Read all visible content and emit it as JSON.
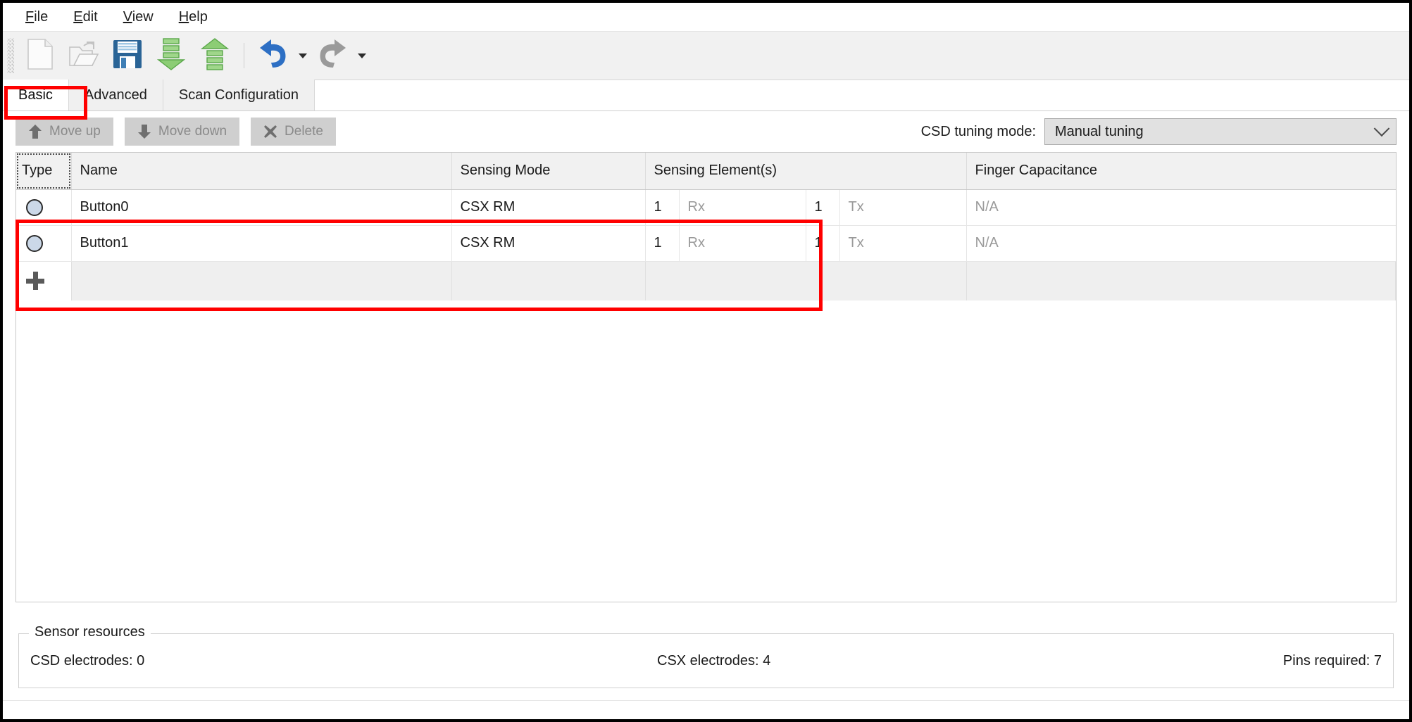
{
  "menu": {
    "items": [
      {
        "name": "file",
        "mnemonic": "F",
        "rest": "ile"
      },
      {
        "name": "edit",
        "mnemonic": "E",
        "rest": "dit"
      },
      {
        "name": "view",
        "mnemonic": "V",
        "rest": "iew"
      },
      {
        "name": "help",
        "mnemonic": "H",
        "rest": "elp"
      }
    ]
  },
  "toolbar": {
    "buttons": [
      {
        "icon": "new-document-icon",
        "enabled": false
      },
      {
        "icon": "open-folder-icon",
        "enabled": false
      },
      {
        "icon": "save-floppy-icon",
        "enabled": true
      },
      {
        "icon": "apply-to-device-down-arrow-icon",
        "enabled": true
      },
      {
        "icon": "read-from-device-up-arrow-icon",
        "enabled": true
      },
      {
        "icon": "undo-icon",
        "enabled": true
      },
      {
        "icon": "redo-icon",
        "enabled": false
      }
    ]
  },
  "tabs": [
    {
      "label": "Basic",
      "active": true
    },
    {
      "label": "Advanced",
      "active": false
    },
    {
      "label": "Scan Configuration",
      "active": false
    }
  ],
  "actions": {
    "move_up_label": "Move up",
    "move_down_label": "Move down",
    "delete_label": "Delete",
    "tuning_mode_label": "CSD tuning mode:",
    "tuning_mode_value": "Manual tuning"
  },
  "table": {
    "headers": {
      "type": "Type",
      "name": "Name",
      "sensing_mode": "Sensing Mode",
      "sensing_elements": "Sensing Element(s)",
      "finger_capacitance": "Finger Capacitance"
    },
    "rows": [
      {
        "type_icon": "button-widget-icon",
        "name": "Button0",
        "sensing_mode": "CSX RM",
        "rx_count": "1",
        "rx_label": "Rx",
        "tx_count": "1",
        "tx_label": "Tx",
        "finger_capacitance": "N/A"
      },
      {
        "type_icon": "button-widget-icon",
        "name": "Button1",
        "sensing_mode": "CSX RM",
        "rx_count": "1",
        "rx_label": "Rx",
        "tx_count": "1",
        "tx_label": "Tx",
        "finger_capacitance": "N/A"
      }
    ],
    "add_row_icon": "plus-icon"
  },
  "resources": {
    "title": "Sensor resources",
    "csd_electrodes": "CSD electrodes:  0",
    "csx_electrodes": "CSX electrodes:  4",
    "pins_required": "Pins required:  7"
  },
  "annotations": {
    "highlight_color": "#ff0000",
    "boxes": [
      "basic-tab",
      "widget-rows"
    ]
  }
}
